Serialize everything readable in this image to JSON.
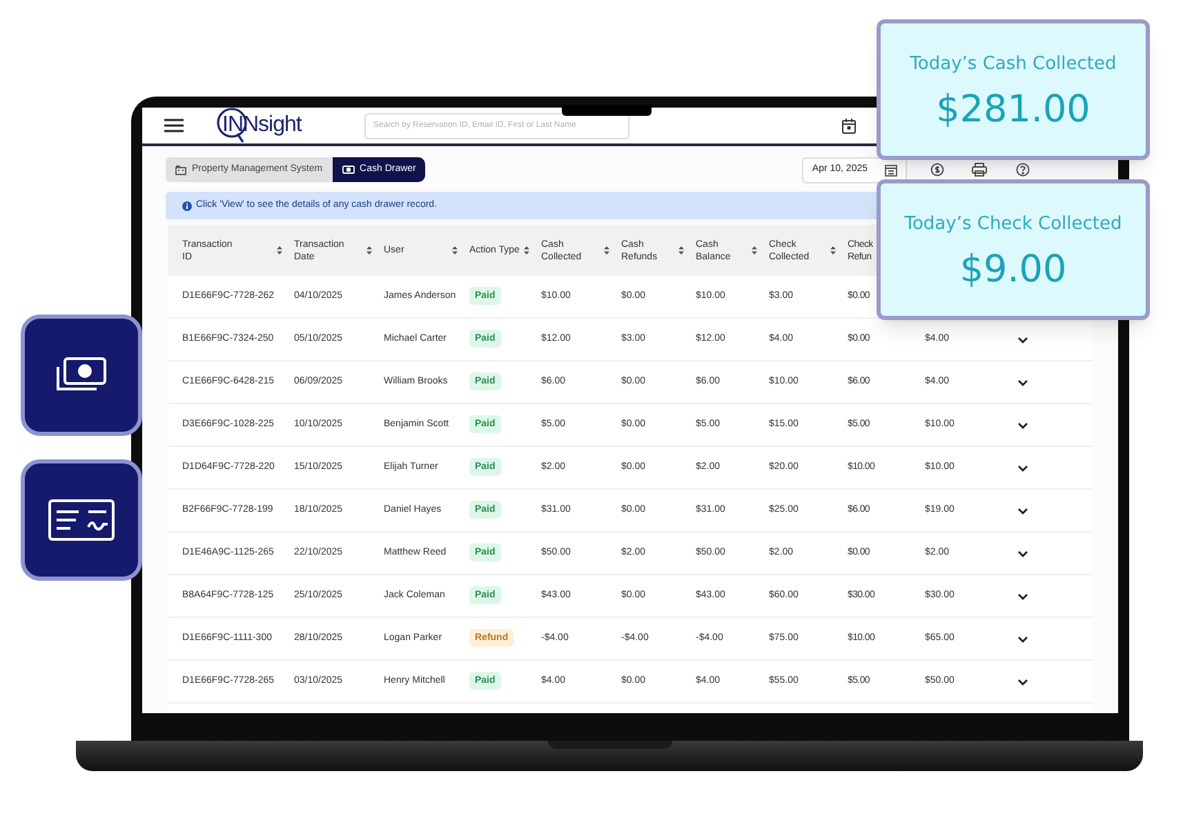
{
  "header": {
    "logo": "INNsight",
    "search": {
      "placeholder": "Search by Reservation ID, Email ID, First or Last Name"
    }
  },
  "breadcrumbs": [
    {
      "label": "Property Management System",
      "selected": false
    },
    {
      "label": "Cash Drawer",
      "selected": true
    }
  ],
  "date_picker": {
    "value": "Apr 10, 2025"
  },
  "info_banner": "Click 'View' to see the details of any cash drawer record.",
  "table": {
    "columns": [
      {
        "label": "Transaction ID",
        "sortable": true
      },
      {
        "label": "Transaction Date",
        "sortable": true
      },
      {
        "label": "User",
        "sortable": true
      },
      {
        "label": "Action Type",
        "sortable": true
      },
      {
        "label": "Cash Collected",
        "sortable": true
      },
      {
        "label": "Cash Refunds",
        "sortable": true
      },
      {
        "label": "Cash Balance",
        "sortable": true
      },
      {
        "label": "Check Collected",
        "sortable": true
      },
      {
        "label": "Check Refun",
        "sortable": false
      }
    ],
    "rows": [
      {
        "transaction_id": "D1E66F9C-7728-262",
        "date": "04/10/2025",
        "user": "James Anderson",
        "action": {
          "label": "Paid",
          "kind": "paid"
        },
        "amounts": [
          "$10.00",
          "$0.00",
          "$10.00",
          "$3.00",
          "$0.00"
        ]
      },
      {
        "transaction_id": "B1E66F9C-7324-250",
        "date": "05/10/2025",
        "user": "Michael Carter",
        "action": {
          "label": "Paid",
          "kind": "paid"
        },
        "amounts": [
          "$12.00",
          "$3.00",
          "$12.00",
          "$4.00",
          "$0.00",
          "$4.00"
        ]
      },
      {
        "transaction_id": "C1E66F9C-6428-215",
        "date": "06/09/2025",
        "user": "William Brooks",
        "action": {
          "label": "Paid",
          "kind": "paid"
        },
        "amounts": [
          "$6.00",
          "$0.00",
          "$6.00",
          "$10.00",
          "$6.00",
          "$4.00"
        ]
      },
      {
        "transaction_id": "D3E66F9C-1028-225",
        "date": "10/10/2025",
        "user": "Benjamin Scott",
        "action": {
          "label": "Paid",
          "kind": "paid"
        },
        "amounts": [
          "$5.00",
          "$0.00",
          "$5.00",
          "$15.00",
          "$5.00",
          "$10.00"
        ]
      },
      {
        "transaction_id": "D1D64F9C-7728-220",
        "date": "15/10/2025",
        "user": "Elijah Turner",
        "action": {
          "label": "Paid",
          "kind": "paid"
        },
        "amounts": [
          "$2.00",
          "$0.00",
          "$2.00",
          "$20.00",
          "$10.00",
          "$10.00"
        ]
      },
      {
        "transaction_id": "B2F66F9C-7728-199",
        "date": "18/10/2025",
        "user": "Daniel Hayes",
        "action": {
          "label": "Paid",
          "kind": "paid"
        },
        "amounts": [
          "$31.00",
          "$0.00",
          "$31.00",
          "$25.00",
          "$6.00",
          "$19.00"
        ]
      },
      {
        "transaction_id": "D1E46A9C-1125-265",
        "date": "22/10/2025",
        "user": "Matthew Reed",
        "action": {
          "label": "Paid",
          "kind": "paid"
        },
        "amounts": [
          "$50.00",
          "$2.00",
          "$50.00",
          "$2.00",
          "$0.00",
          "$2.00"
        ]
      },
      {
        "transaction_id": "B8A64F9C-7728-125",
        "date": "25/10/2025",
        "user": "Jack Coleman",
        "action": {
          "label": "Paid",
          "kind": "paid"
        },
        "amounts": [
          "$43.00",
          "$0.00",
          "$43.00",
          "$60.00",
          "$30.00",
          "$30.00"
        ]
      },
      {
        "transaction_id": "D1E66F9C-1111-300",
        "date": "28/10/2025",
        "user": "Logan Parker",
        "action": {
          "label": "Refund",
          "kind": "refund"
        },
        "amounts": [
          "-$4.00",
          "-$4.00",
          "-$4.00",
          "$75.00",
          "$10.00",
          "$65.00"
        ]
      },
      {
        "transaction_id": "D1E66F9C-7728-265",
        "date": "03/10/2025",
        "user": "Henry Mitchell",
        "action": {
          "label": "Paid",
          "kind": "paid"
        },
        "amounts": [
          "$4.00",
          "$0.00",
          "$4.00",
          "$55.00",
          "$5.00",
          "$50.00"
        ]
      }
    ]
  },
  "summary_cards": [
    {
      "title": "Today’s Cash Collected",
      "value": "$281.00"
    },
    {
      "title": "Today’s Check Collected",
      "value": "$9.00"
    }
  ],
  "side_badges": [
    {
      "kind": "cash"
    },
    {
      "kind": "check"
    }
  ]
}
